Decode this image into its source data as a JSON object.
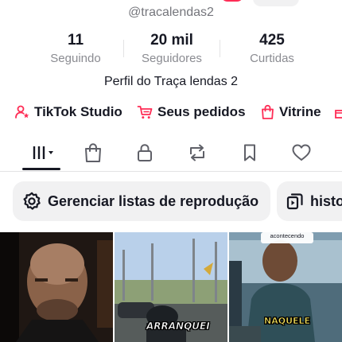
{
  "profile": {
    "username": "@tracalendas2",
    "bio": "Perfil do Traça lendas 2"
  },
  "stats": [
    {
      "value": "11",
      "label": "Seguindo"
    },
    {
      "value": "20 mil",
      "label": "Seguidores"
    },
    {
      "value": "425",
      "label": "Curtidas"
    }
  ],
  "links": [
    {
      "label": "TikTok Studio",
      "icon": "person-star-icon"
    },
    {
      "label": "Seus pedidos",
      "icon": "cart-icon"
    },
    {
      "label": "Vitrine",
      "icon": "shopping-bag-icon"
    }
  ],
  "tabs": [
    "videos-grid-icon",
    "shop-bag-icon",
    "lock-icon",
    "repost-icon",
    "bookmark-icon",
    "heart-icon"
  ],
  "chips": [
    {
      "label": "Gerenciar listas de reprodução",
      "icon": "gear-icon"
    },
    {
      "label": "histo",
      "icon": "history-icon"
    }
  ],
  "videos": [
    {
      "caption": "",
      "top_caption": ""
    },
    {
      "caption": "ARRANQUEI",
      "top_caption": ""
    },
    {
      "caption": "NAQUELE",
      "top_caption": "acontecendo"
    }
  ],
  "colors": {
    "accent": "#fe2c55",
    "text": "#161823",
    "muted": "#8a8b91",
    "chip_bg": "#f1f1f2"
  }
}
